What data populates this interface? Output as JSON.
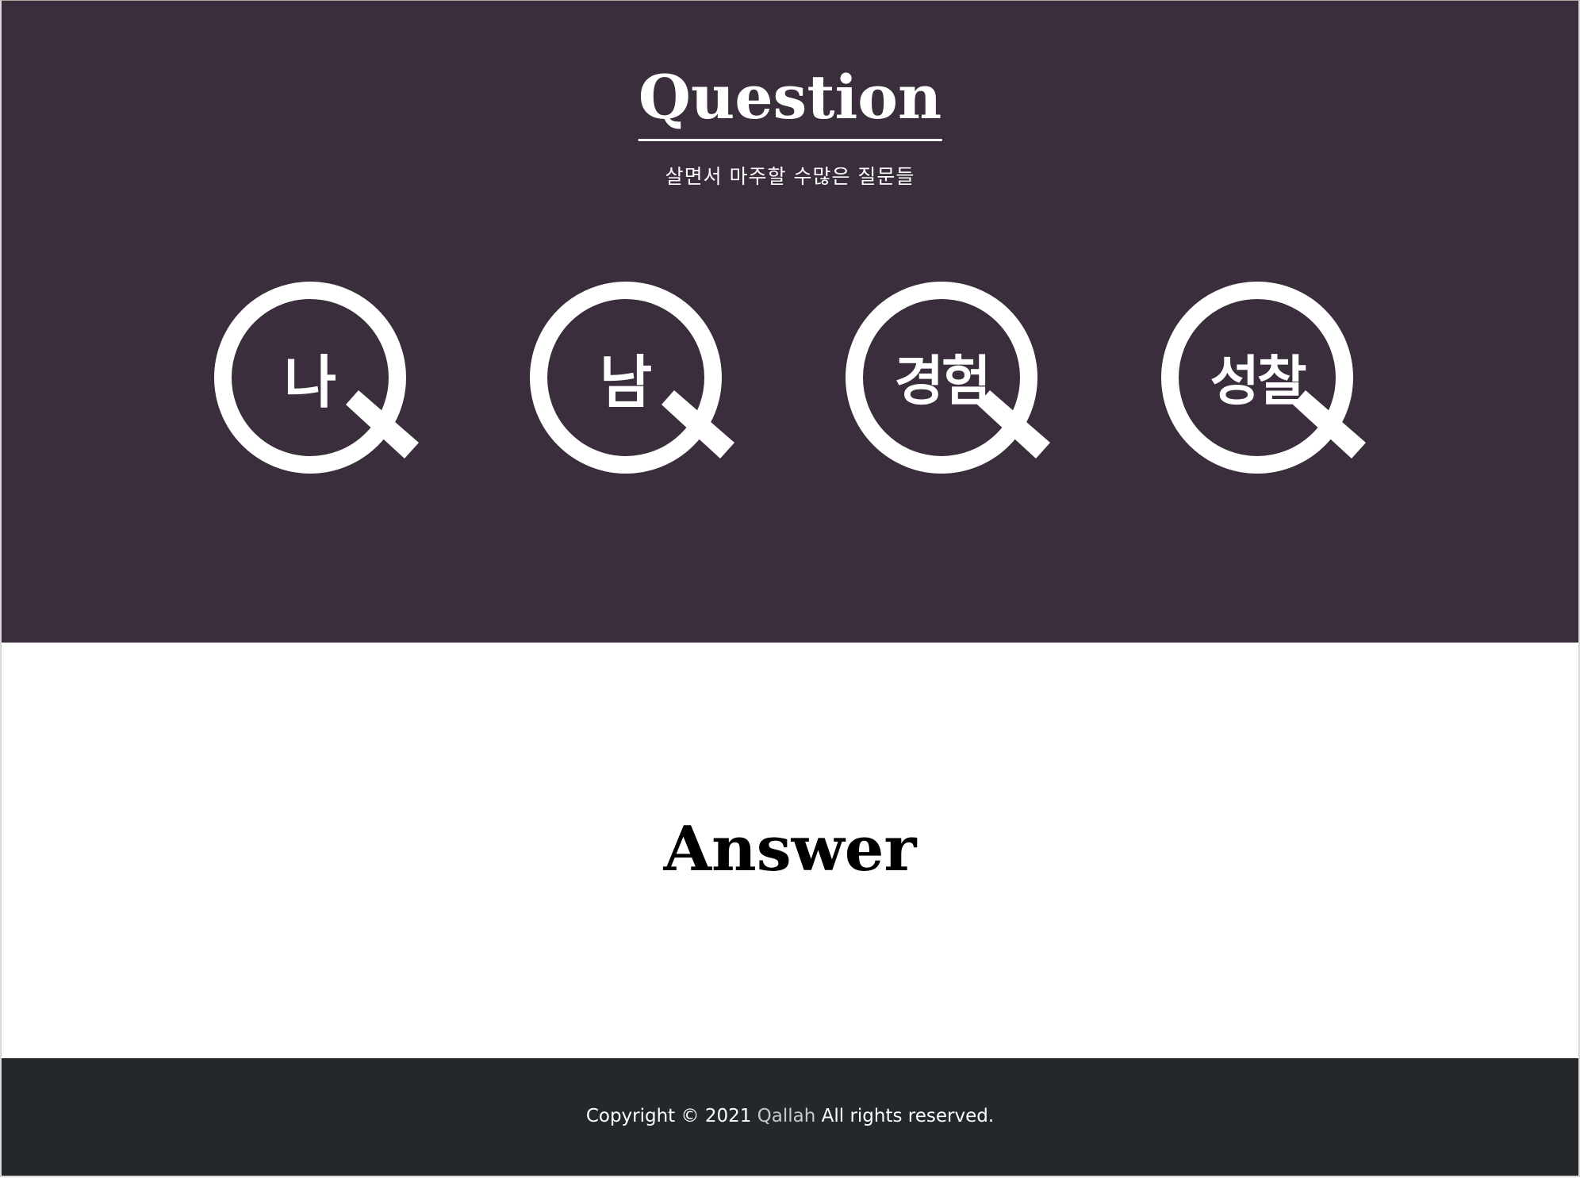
{
  "question": {
    "title": "Question",
    "subtitle": "살면서 마주할 수많은 질문들",
    "categories": [
      {
        "label": "나"
      },
      {
        "label": "남"
      },
      {
        "label": "경험"
      },
      {
        "label": "성찰"
      }
    ]
  },
  "answer": {
    "title": "Answer"
  },
  "footer": {
    "prefix": "Copyright © 2021 ",
    "brand": "Qallah",
    "suffix": " All rights reserved."
  },
  "colors": {
    "question_bg": "#3a2d3c",
    "answer_bg": "#ffffff",
    "footer_bg": "#24282b",
    "brand_link": "#c8c8c8"
  }
}
